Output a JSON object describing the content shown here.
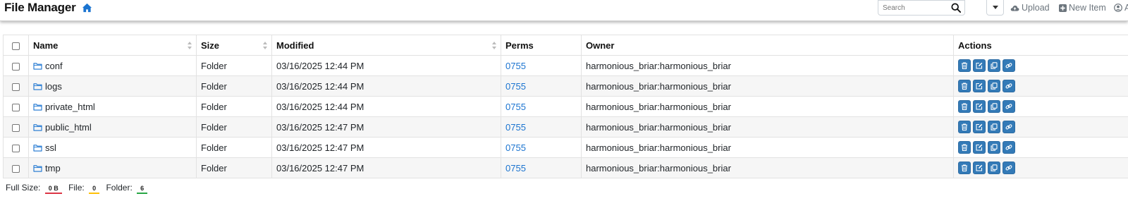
{
  "header": {
    "title": "File Manager",
    "search_placeholder": "Search",
    "upload_label": "Upload",
    "new_item_label": "New Item",
    "account_label": "A"
  },
  "table": {
    "columns": {
      "name": "Name",
      "size": "Size",
      "modified": "Modified",
      "perms": "Perms",
      "owner": "Owner",
      "actions": "Actions"
    },
    "rows": [
      {
        "name": "conf",
        "size": "Folder",
        "modified": "03/16/2025 12:44 PM",
        "perms": "0755",
        "owner": "harmonious_briar:harmonious_briar"
      },
      {
        "name": "logs",
        "size": "Folder",
        "modified": "03/16/2025 12:44 PM",
        "perms": "0755",
        "owner": "harmonious_briar:harmonious_briar"
      },
      {
        "name": "private_html",
        "size": "Folder",
        "modified": "03/16/2025 12:44 PM",
        "perms": "0755",
        "owner": "harmonious_briar:harmonious_briar"
      },
      {
        "name": "public_html",
        "size": "Folder",
        "modified": "03/16/2025 12:47 PM",
        "perms": "0755",
        "owner": "harmonious_briar:harmonious_briar"
      },
      {
        "name": "ssl",
        "size": "Folder",
        "modified": "03/16/2025 12:47 PM",
        "perms": "0755",
        "owner": "harmonious_briar:harmonious_briar"
      },
      {
        "name": "tmp",
        "size": "Folder",
        "modified": "03/16/2025 12:47 PM",
        "perms": "0755",
        "owner": "harmonious_briar:harmonious_briar"
      }
    ],
    "row_actions": [
      "delete-icon",
      "rename-icon",
      "copy-icon",
      "link-icon"
    ]
  },
  "footer": {
    "full_size_label": "Full Size:",
    "full_size_value": "0 B",
    "file_label": "File:",
    "file_value": "0",
    "folder_label": "Folder:",
    "folder_value": "6"
  },
  "colors": {
    "accent": "#1b74d0",
    "action_button": "#337ab7",
    "badge_size": "#dc3545",
    "badge_file": "#ffc107",
    "badge_folder": "#28a745"
  }
}
